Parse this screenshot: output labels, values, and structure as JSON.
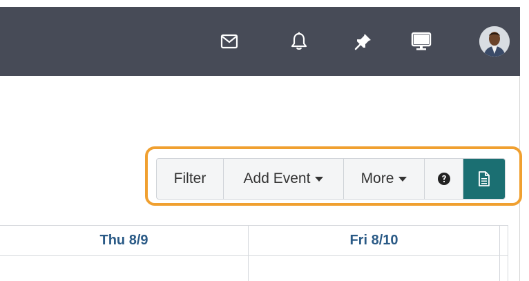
{
  "topbar": {
    "icons": [
      "mail-icon",
      "bell-icon",
      "pin-icon",
      "monitor-icon",
      "avatar"
    ]
  },
  "toolbar": {
    "filter_label": "Filter",
    "add_event_label": "Add Event",
    "more_label": "More",
    "help_icon": "question-circle-icon",
    "notes_icon": "document-icon"
  },
  "calendar": {
    "columns": [
      {
        "label": "Thu 8/9"
      },
      {
        "label": "Fri 8/10"
      }
    ]
  },
  "colors": {
    "topbar": "#474b57",
    "highlight": "#f0a030",
    "teal_button": "#1b6f72",
    "day_header_text": "#2a5a86"
  }
}
